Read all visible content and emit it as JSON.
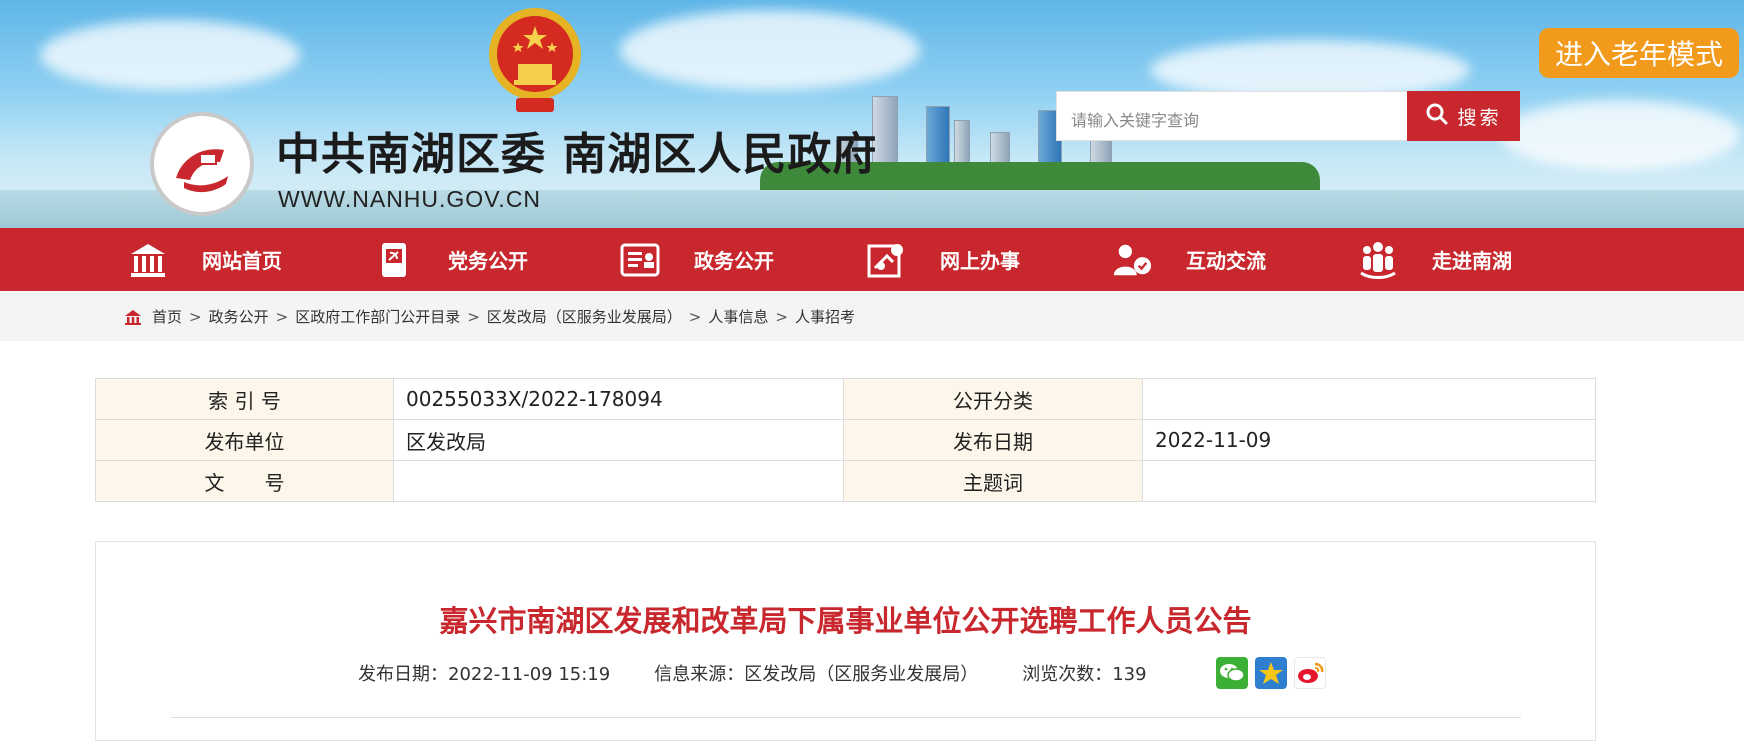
{
  "header": {
    "site_title": "中共南湖区委 南湖区人民政府",
    "site_url": "WWW.NANHU.GOV.CN",
    "search_placeholder": "请输入关键字查询",
    "search_button": "搜索",
    "elder_mode_button": "进入老年模式"
  },
  "nav": {
    "items": [
      {
        "label": "网站首页",
        "icon": "home-icon"
      },
      {
        "label": "党务公开",
        "icon": "party-icon"
      },
      {
        "label": "政务公开",
        "icon": "document-icon"
      },
      {
        "label": "网上办事",
        "icon": "online-service-icon"
      },
      {
        "label": "互动交流",
        "icon": "interaction-icon"
      },
      {
        "label": "走进南湖",
        "icon": "people-icon"
      }
    ]
  },
  "breadcrumb": {
    "items": [
      "首页",
      "政务公开",
      "区政府工作部门公开目录",
      "区发改局（区服务业发展局）",
      "人事信息",
      "人事招考"
    ],
    "separator": ">"
  },
  "info_table": {
    "index_label": "索 引 号",
    "index_value": "00255033X/2022-178094",
    "category_label": "公开分类",
    "category_value": "",
    "publisher_label": "发布单位",
    "publisher_value": "区发改局",
    "date_label": "发布日期",
    "date_value": "2022-11-09",
    "docno_label": "文　　号",
    "docno_value": "",
    "keywords_label": "主题词",
    "keywords_value": ""
  },
  "article": {
    "title": "嘉兴市南湖区发展和改革局下属事业单位公开选聘工作人员公告",
    "publish_date_label": "发布日期：",
    "publish_date": "2022-11-09 15:19",
    "source_label": "信息来源：",
    "source": "区发改局（区服务业发展局）",
    "views_label": "浏览次数：",
    "views": "139"
  },
  "share": {
    "items": [
      "wechat-icon",
      "qzone-icon",
      "weibo-icon"
    ]
  },
  "colors": {
    "primary_red": "#c8282d",
    "elder_orange": "#f29a1c",
    "table_key_bg": "#fdf6ea"
  }
}
